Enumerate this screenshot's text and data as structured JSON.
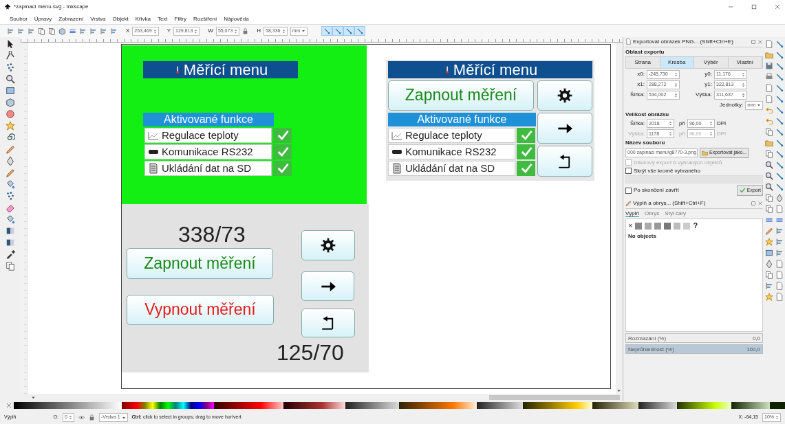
{
  "window": {
    "title": "*zapinaci menu.svg - Inkscape"
  },
  "menu": [
    "Soubor",
    "Úpravy",
    "Zobrazení",
    "Vrstva",
    "Objekt",
    "Křivka",
    "Text",
    "Filtry",
    "Rozšíření",
    "Nápověda"
  ],
  "toolbar": {
    "fields": [
      {
        "label": "X",
        "value": "253,469"
      },
      {
        "label": "Y",
        "value": "129,813"
      },
      {
        "label": "W",
        "value": "55,073"
      },
      {
        "label": "H",
        "value": "58,336"
      }
    ],
    "unit": "mm"
  },
  "screens": [
    {
      "header": "Měřící menu",
      "features_title": "Aktivované funkce",
      "features": [
        {
          "label": "Regulace teploty",
          "checked": true
        },
        {
          "label": "Komunikace RS232",
          "checked": true
        },
        {
          "label": "Ukládání dat na SD",
          "checked": true
        }
      ],
      "counter_top": "338/73",
      "on_button": "Zapnout měření",
      "off_button": "Vypnout měření",
      "counter_bottom": "125/70"
    },
    {
      "header": "Měřící menu",
      "features_title": "Aktivované funkce",
      "features": [
        {
          "label": "Regulace teploty",
          "checked": true
        },
        {
          "label": "Komunikace RS232",
          "checked": true
        },
        {
          "label": "Ukládání dat na SD",
          "checked": true
        }
      ],
      "on_button": "Zapnout měření"
    }
  ],
  "export_panel": {
    "title": "Exportovat obrázek PNG... (Shift+Ctrl+E)",
    "area_heading": "Oblast exportu",
    "area_tabs": [
      {
        "label": "Strana",
        "selected": false
      },
      {
        "label": "Kresba",
        "selected": true
      },
      {
        "label": "Výběr",
        "selected": false
      },
      {
        "label": "Vlastní",
        "selected": false
      }
    ],
    "coords": [
      {
        "left": {
          "label": "x0:",
          "value": "-245,730"
        },
        "right": {
          "label": "y0:",
          "value": "11,176"
        }
      },
      {
        "left": {
          "label": "x1:",
          "value": "288,272"
        },
        "right": {
          "label": "y1:",
          "value": "322,813"
        }
      },
      {
        "left": {
          "label": "Šířka:",
          "value": "534,002"
        },
        "right": {
          "label": "Výška:",
          "value": "311,637"
        }
      }
    ],
    "units_label": "Jednotky:",
    "unit": "mm",
    "size_heading": "Velikost obrázku",
    "size_rows": [
      {
        "label": "Šířka:",
        "value": "2018",
        "at": "při",
        "dpi": "96,00",
        "unit": "DPI",
        "disabled": false
      },
      {
        "label": "Výška:",
        "value": "1178",
        "at": "při",
        "dpi": "96,00",
        "unit": "DPI",
        "disabled": true
      }
    ],
    "filename_heading": "Název souboru",
    "filename": "000 zapinaci menu\\g8770-3.png",
    "export_as": "Exportovat jako...",
    "options": [
      {
        "label": "Dávkový export 6 vybraných objektů",
        "checked": false,
        "disabled": true
      },
      {
        "label": "Skrýt vše kromě vybraného",
        "checked": false,
        "disabled": false
      }
    ],
    "close_after": {
      "label": "Po skončení zavřít",
      "checked": false
    },
    "export_button": "Export"
  },
  "fill_panel": {
    "title": "Výplň a obrys... (Shift+Ctrl+F)",
    "tabs": [
      {
        "label": "Výplň",
        "selected": true
      },
      {
        "label": "Obrys",
        "selected": false
      },
      {
        "label": "Styl čáry",
        "selected": false
      }
    ],
    "no_paint": "×",
    "unset": "?",
    "status": "No objects",
    "sliders": [
      {
        "label": "Rozmazání (%)",
        "value": "0,0",
        "level": 0
      },
      {
        "label": "Neprůhlednost (%)",
        "value": "100,0",
        "level": 1
      }
    ]
  },
  "status_bar": {
    "fill_label": "Výplň",
    "opacity_label": "O:",
    "opacity": "0",
    "layer": "-Vrstva 1",
    "message": "**Ctrl:** click to select in groups; drag to move hor/vert",
    "cursor": "X: -64,15",
    "zoom": "10%"
  }
}
